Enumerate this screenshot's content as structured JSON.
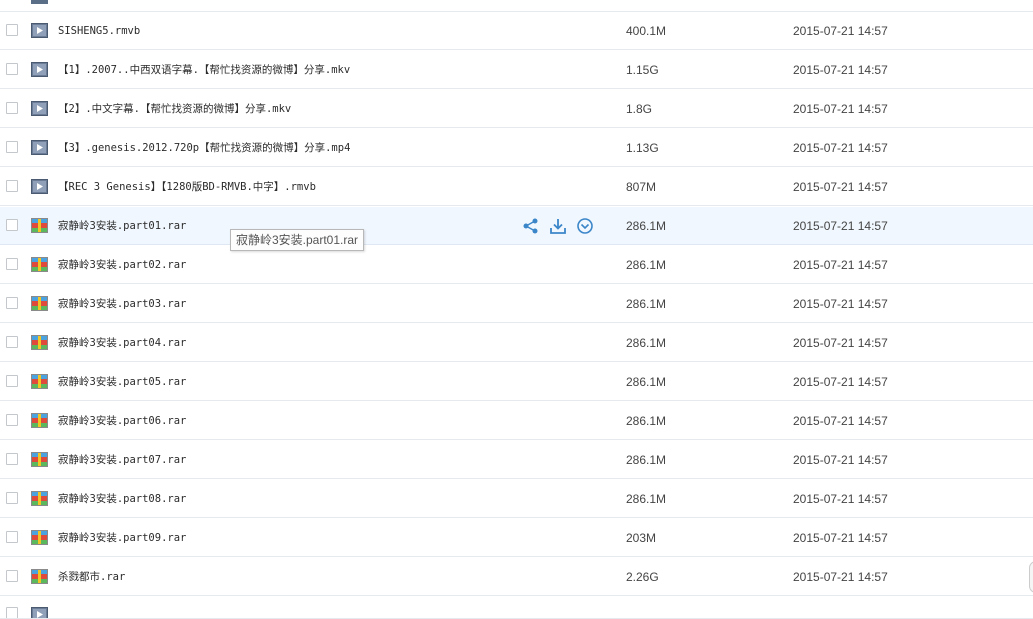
{
  "tooltip": "寂静岭3安装.part01.rar",
  "colors": {
    "hover_row": "#f1f7fe",
    "action_icon": "#3b86c9"
  },
  "files": [
    {
      "name": "SISHENG5.rmvb",
      "size": "400.1M",
      "date": "2015-07-21 14:57",
      "icon": "video-file-icon"
    },
    {
      "name": "【1】.2007..中西双语字幕.【帮忙找资源的微博】分享.mkv",
      "size": "1.15G",
      "date": "2015-07-21 14:57",
      "icon": "video-file-icon"
    },
    {
      "name": "【2】.中文字幕.【帮忙找资源的微博】分享.mkv",
      "size": "1.8G",
      "date": "2015-07-21 14:57",
      "icon": "video-file-icon"
    },
    {
      "name": "【3】.genesis.2012.720p【帮忙找资源的微博】分享.mp4",
      "size": "1.13G",
      "date": "2015-07-21 14:57",
      "icon": "video-file-icon"
    },
    {
      "name": "【REC 3 Genesis】【1280版BD-RMVB.中字】.rmvb",
      "size": "807M",
      "date": "2015-07-21 14:57",
      "icon": "video-file-icon"
    },
    {
      "name": "寂静岭3安装.part01.rar",
      "size": "286.1M",
      "date": "2015-07-21 14:57",
      "icon": "archive-file-icon"
    },
    {
      "name": "寂静岭3安装.part02.rar",
      "size": "286.1M",
      "date": "2015-07-21 14:57",
      "icon": "archive-file-icon"
    },
    {
      "name": "寂静岭3安装.part03.rar",
      "size": "286.1M",
      "date": "2015-07-21 14:57",
      "icon": "archive-file-icon"
    },
    {
      "name": "寂静岭3安装.part04.rar",
      "size": "286.1M",
      "date": "2015-07-21 14:57",
      "icon": "archive-file-icon"
    },
    {
      "name": "寂静岭3安装.part05.rar",
      "size": "286.1M",
      "date": "2015-07-21 14:57",
      "icon": "archive-file-icon"
    },
    {
      "name": "寂静岭3安装.part06.rar",
      "size": "286.1M",
      "date": "2015-07-21 14:57",
      "icon": "archive-file-icon"
    },
    {
      "name": "寂静岭3安装.part07.rar",
      "size": "286.1M",
      "date": "2015-07-21 14:57",
      "icon": "archive-file-icon"
    },
    {
      "name": "寂静岭3安装.part08.rar",
      "size": "286.1M",
      "date": "2015-07-21 14:57",
      "icon": "archive-file-icon"
    },
    {
      "name": "寂静岭3安装.part09.rar",
      "size": "203M",
      "date": "2015-07-21 14:57",
      "icon": "archive-file-icon"
    },
    {
      "name": "杀戮都市.rar",
      "size": "2.26G",
      "date": "2015-07-21 14:57",
      "icon": "archive-file-icon"
    }
  ]
}
